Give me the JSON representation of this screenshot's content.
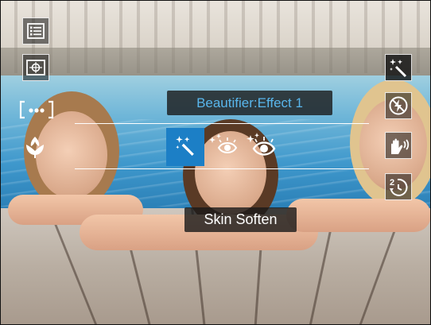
{
  "camera_ui": {
    "left_toolbar": [
      {
        "name": "menu",
        "icon": "menu-list-icon"
      },
      {
        "name": "metering",
        "icon": "metering-icon"
      },
      {
        "name": "focus_area",
        "icon": "focus-bracket-icon"
      },
      {
        "name": "macro",
        "icon": "macro-flower-icon"
      }
    ],
    "right_toolbar": [
      {
        "name": "scene_beautifier",
        "icon": "magic-wand-icon"
      },
      {
        "name": "flash_off",
        "icon": "flash-off-icon"
      },
      {
        "name": "stabilizer",
        "icon": "hand-shake-icon"
      },
      {
        "name": "self_timer",
        "icon": "timer-2s-icon"
      }
    ],
    "mode_popup": {
      "label": "Beautifier:Effect 1"
    },
    "effects": [
      {
        "name": "effect-1",
        "icon": "magic-wand-icon",
        "selected": true
      },
      {
        "name": "effect-2",
        "icon": "eye-sparkle-icon",
        "selected": false
      },
      {
        "name": "effect-3",
        "icon": "eye-sparkle-large-icon",
        "selected": false
      }
    ],
    "tooltip": {
      "label": "Skin Soften"
    },
    "colors": {
      "accent": "#1c7fc6",
      "popup_text": "#59b6ec"
    }
  }
}
